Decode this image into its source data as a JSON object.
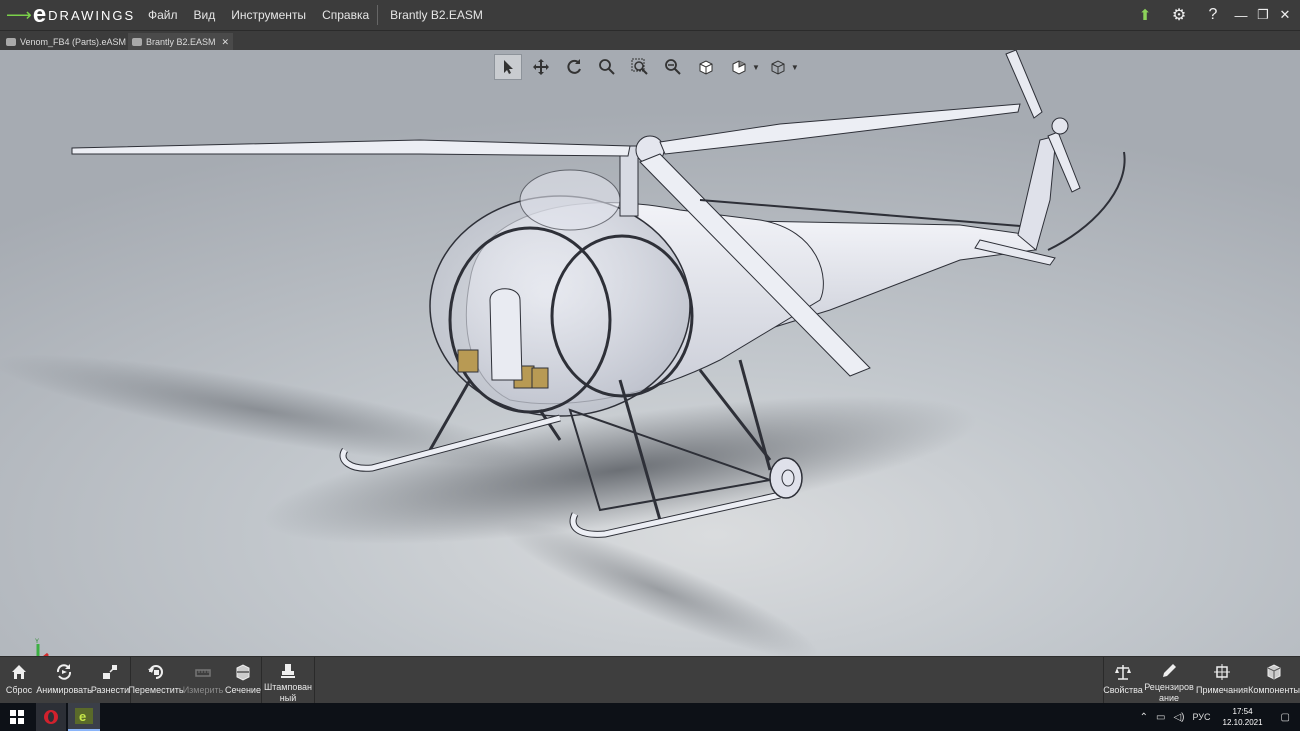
{
  "app": {
    "logo_word": "DRAWINGS",
    "logo_letter": "e",
    "menu": [
      "Файл",
      "Вид",
      "Инструменты",
      "Справка"
    ],
    "document_title": "Brantly B2.EASM"
  },
  "tabs": [
    {
      "label": "Venom_FB4 (Parts).eASM",
      "active": false
    },
    {
      "label": "Brantly B2.EASM",
      "active": true
    }
  ],
  "view_tools": [
    "select-icon",
    "pan-icon",
    "rotate-icon",
    "zoom-to-fit-icon",
    "zoom-to-area-icon",
    "zoom-in-out-icon",
    "standard-views-icon",
    "display-style-icon",
    "view-orientation-icon"
  ],
  "triad": {
    "x": "X",
    "y": "Y",
    "z": "Z"
  },
  "commands_left": [
    {
      "label": "Сброс",
      "icon": "home-icon",
      "enabled": true
    },
    {
      "label": "Анимировать",
      "icon": "animate-icon",
      "enabled": true
    },
    {
      "label": "Разнести",
      "icon": "explode-icon",
      "enabled": true
    },
    {
      "label": "Переместить",
      "icon": "move-icon",
      "enabled": true
    },
    {
      "label": "Измерить",
      "icon": "measure-icon",
      "enabled": false
    },
    {
      "label": "Сечение",
      "icon": "section-icon",
      "enabled": true
    },
    {
      "label": "Штампованный",
      "icon": "stamp-icon",
      "enabled": true
    }
  ],
  "commands_right": [
    {
      "label": "Свойства",
      "icon": "scales-icon"
    },
    {
      "label": "Рецензирование",
      "icon": "pen-icon"
    },
    {
      "label": "Примечания",
      "icon": "markup-icon"
    },
    {
      "label": "Компоненты",
      "icon": "components-icon"
    }
  ],
  "taskbar": {
    "language": "РУС",
    "time": "17:54",
    "date": "12.10.2021"
  },
  "colors": {
    "titlebar": "#3c3c3c",
    "viewport_top": "#a6abb2",
    "viewport_bottom": "#dadcde",
    "model": "#e4e6ee",
    "logo_green": "#7bd14a"
  }
}
